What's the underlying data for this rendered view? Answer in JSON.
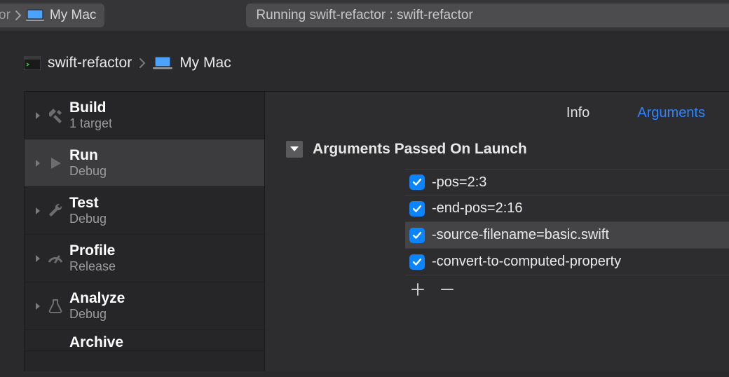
{
  "toolbar": {
    "scheme_partial": "or",
    "scheme_device": "My Mac",
    "status_text": "Running swift-refactor : swift-refactor"
  },
  "breadcrumb": {
    "target": "swift-refactor",
    "device": "My Mac"
  },
  "phases": [
    {
      "title": "Build",
      "sub": "1 target",
      "icon": "hammer"
    },
    {
      "title": "Run",
      "sub": "Debug",
      "icon": "play",
      "selected": true
    },
    {
      "title": "Test",
      "sub": "Debug",
      "icon": "wrench"
    },
    {
      "title": "Profile",
      "sub": "Release",
      "icon": "gauge"
    },
    {
      "title": "Analyze",
      "sub": "Debug",
      "icon": "analyze"
    },
    {
      "title": "Archive",
      "sub": "",
      "icon": "archive"
    }
  ],
  "tabs": {
    "info": "Info",
    "arguments": "Arguments",
    "active": "arguments"
  },
  "section": {
    "title": "Arguments Passed On Launch"
  },
  "arguments": [
    {
      "checked": true,
      "text": "-pos=2:3"
    },
    {
      "checked": true,
      "text": "-end-pos=2:16"
    },
    {
      "checked": true,
      "text": "-source-filename=basic.swift",
      "selected": true
    },
    {
      "checked": true,
      "text": "-convert-to-computed-property"
    }
  ]
}
